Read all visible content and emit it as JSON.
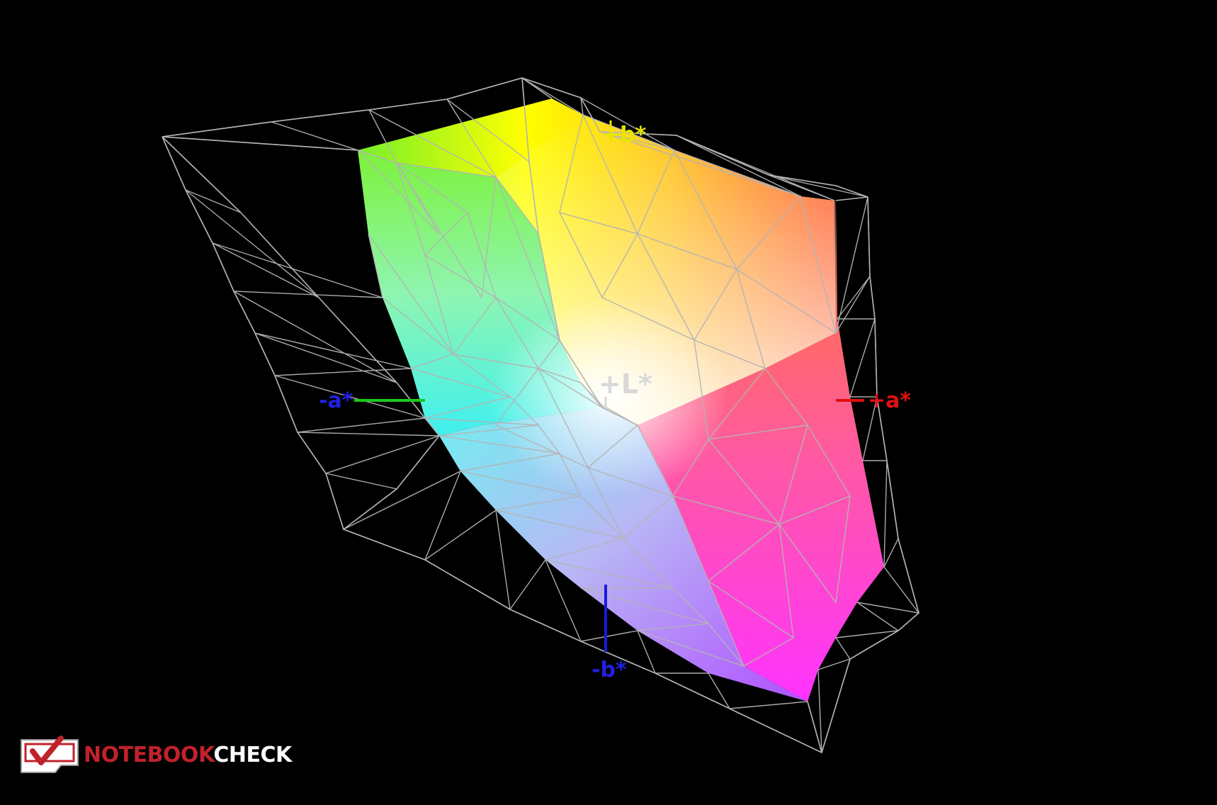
{
  "diagram": {
    "type": "3d-color-gamut-lab",
    "axes": {
      "plus_b": "+b*",
      "minus_b": "-b*",
      "plus_a": "+a*",
      "minus_a": "-a*",
      "plus_L": "+L*"
    },
    "colors": {
      "background": "#000000",
      "wireframe": "#b4b4b4",
      "axis_plus_a": "#e01010",
      "axis_minus_a": "#1ec81e",
      "axis_minus_b": "#1a1ad8",
      "axis_plus_b": "#e6e600",
      "axis_plus_L": "#d8d8d8"
    }
  },
  "logo": {
    "name_part1": "NOTEBOOK",
    "name_part2": "CHECK",
    "icon": "checkmark-laptop-icon"
  }
}
